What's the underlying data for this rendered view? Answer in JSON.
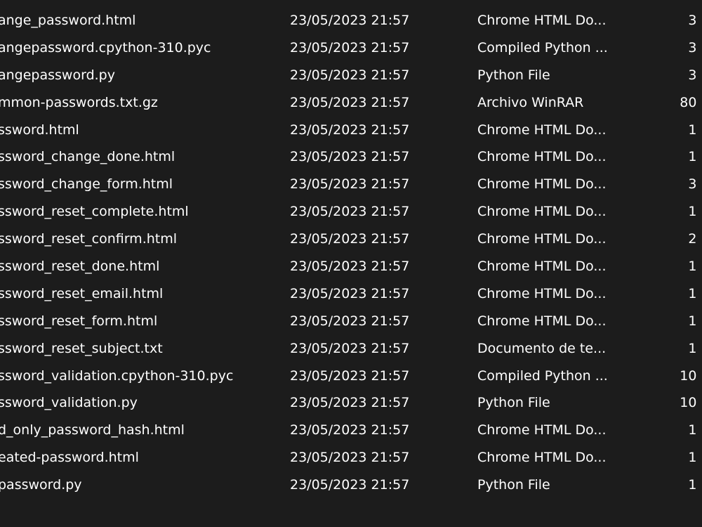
{
  "colors": {
    "background": "#1c1c1c",
    "text": "#ffffff"
  },
  "files": [
    {
      "name": "ange_password.html",
      "date": "23/05/2023 21:57",
      "type": "Chrome HTML Do...",
      "size": "3 KB"
    },
    {
      "name": "angepassword.cpython-310.pyc",
      "date": "23/05/2023 21:57",
      "type": "Compiled Python ...",
      "size": "3 KB"
    },
    {
      "name": "angepassword.py",
      "date": "23/05/2023 21:57",
      "type": "Python File",
      "size": "3 KB"
    },
    {
      "name": "mmon-passwords.txt.gz",
      "date": "23/05/2023 21:57",
      "type": "Archivo WinRAR",
      "size": "80 KB"
    },
    {
      "name": "ssword.html",
      "date": "23/05/2023 21:57",
      "type": "Chrome HTML Do...",
      "size": "1 KB"
    },
    {
      "name": "ssword_change_done.html",
      "date": "23/05/2023 21:57",
      "type": "Chrome HTML Do...",
      "size": "1 KB"
    },
    {
      "name": "ssword_change_form.html",
      "date": "23/05/2023 21:57",
      "type": "Chrome HTML Do...",
      "size": "3 KB"
    },
    {
      "name": "ssword_reset_complete.html",
      "date": "23/05/2023 21:57",
      "type": "Chrome HTML Do...",
      "size": "1 KB"
    },
    {
      "name": "ssword_reset_confirm.html",
      "date": "23/05/2023 21:57",
      "type": "Chrome HTML Do...",
      "size": "2 KB"
    },
    {
      "name": "ssword_reset_done.html",
      "date": "23/05/2023 21:57",
      "type": "Chrome HTML Do...",
      "size": "1 KB"
    },
    {
      "name": "ssword_reset_email.html",
      "date": "23/05/2023 21:57",
      "type": "Chrome HTML Do...",
      "size": "1 KB"
    },
    {
      "name": "ssword_reset_form.html",
      "date": "23/05/2023 21:57",
      "type": "Chrome HTML Do...",
      "size": "1 KB"
    },
    {
      "name": "ssword_reset_subject.txt",
      "date": "23/05/2023 21:57",
      "type": "Documento de te...",
      "size": "1 KB"
    },
    {
      "name": "ssword_validation.cpython-310.pyc",
      "date": "23/05/2023 21:57",
      "type": "Compiled Python ...",
      "size": "10 KB"
    },
    {
      "name": "ssword_validation.py",
      "date": "23/05/2023 21:57",
      "type": "Python File",
      "size": "10 KB"
    },
    {
      "name": "d_only_password_hash.html",
      "date": "23/05/2023 21:57",
      "type": "Chrome HTML Do...",
      "size": "1 KB"
    },
    {
      "name": "eated-password.html",
      "date": "23/05/2023 21:57",
      "type": "Chrome HTML Do...",
      "size": "1 KB"
    },
    {
      "name": "password.py",
      "date": "23/05/2023 21:57",
      "type": "Python File",
      "size": "1 KB"
    }
  ]
}
